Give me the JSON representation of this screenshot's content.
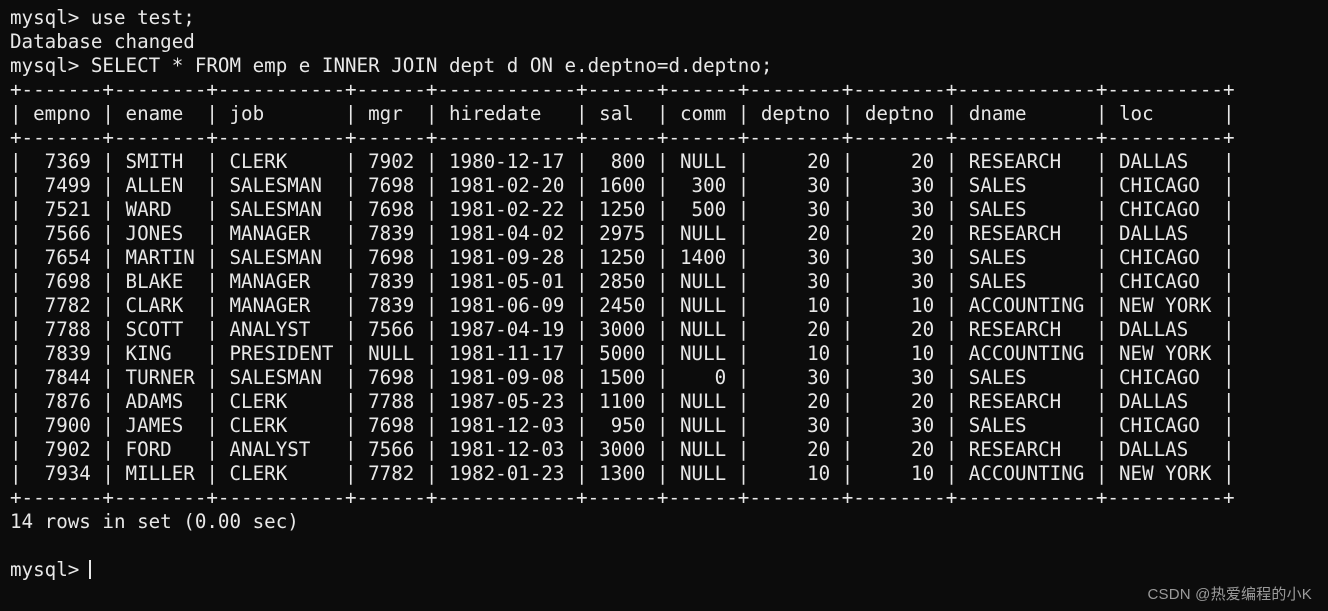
{
  "terminal": {
    "background_color": "#0c0c0c",
    "text_color": "#e8e8e8",
    "prompt": "mysql>",
    "session": [
      {
        "kind": "command",
        "text": "mysql> use test;"
      },
      {
        "kind": "output",
        "text": "Database changed"
      },
      {
        "kind": "command",
        "text": "mysql> SELECT * FROM emp e INNER JOIN dept d ON e.deptno=d.deptno;"
      }
    ],
    "result_footer": "14 rows in set (0.00 sec)",
    "blank_line": "",
    "final_prompt": "mysql>",
    "cursor": "block-cursor"
  },
  "query": {
    "use_statement": "use test;",
    "database": "test",
    "select_statement": "SELECT * FROM emp e INNER JOIN dept d ON e.deptno=d.deptno;",
    "row_count": 14,
    "elapsed": "0.00 sec"
  },
  "result_table": {
    "rule_top": "+-------+--------+-----------+------+------------+------+------+--------+--------+------------+----------+",
    "rule_mid": "+-------+--------+-----------+------+------------+------+------+--------+--------+------------+----------+",
    "rule_bottom": "+-------+--------+-----------+------+------------+------+------+--------+--------+------------+----------+",
    "columns": [
      {
        "name": "empno",
        "width": 5,
        "align": "right"
      },
      {
        "name": "ename",
        "width": 6,
        "align": "left"
      },
      {
        "name": "job",
        "width": 9,
        "align": "left"
      },
      {
        "name": "mgr",
        "width": 4,
        "align": "right"
      },
      {
        "name": "hiredate",
        "width": 10,
        "align": "left"
      },
      {
        "name": "sal",
        "width": 4,
        "align": "right"
      },
      {
        "name": "comm",
        "width": 4,
        "align": "right"
      },
      {
        "name": "deptno",
        "width": 6,
        "align": "right"
      },
      {
        "name": "deptno",
        "width": 6,
        "align": "right"
      },
      {
        "name": "dname",
        "width": 10,
        "align": "left"
      },
      {
        "name": "loc",
        "width": 8,
        "align": "left"
      }
    ],
    "header_line": "| empno | ename  | job       | mgr  | hiredate   | sal  | comm | deptno | deptno | dname      | loc      |",
    "rows": [
      {
        "empno": "7369",
        "ename": "SMITH",
        "job": "CLERK",
        "mgr": "7902",
        "hiredate": "1980-12-17",
        "sal": "800",
        "comm": "NULL",
        "e_deptno": "20",
        "d_deptno": "20",
        "dname": "RESEARCH",
        "loc": "DALLAS"
      },
      {
        "empno": "7499",
        "ename": "ALLEN",
        "job": "SALESMAN",
        "mgr": "7698",
        "hiredate": "1981-02-20",
        "sal": "1600",
        "comm": "300",
        "e_deptno": "30",
        "d_deptno": "30",
        "dname": "SALES",
        "loc": "CHICAGO"
      },
      {
        "empno": "7521",
        "ename": "WARD",
        "job": "SALESMAN",
        "mgr": "7698",
        "hiredate": "1981-02-22",
        "sal": "1250",
        "comm": "500",
        "e_deptno": "30",
        "d_deptno": "30",
        "dname": "SALES",
        "loc": "CHICAGO"
      },
      {
        "empno": "7566",
        "ename": "JONES",
        "job": "MANAGER",
        "mgr": "7839",
        "hiredate": "1981-04-02",
        "sal": "2975",
        "comm": "NULL",
        "e_deptno": "20",
        "d_deptno": "20",
        "dname": "RESEARCH",
        "loc": "DALLAS"
      },
      {
        "empno": "7654",
        "ename": "MARTIN",
        "job": "SALESMAN",
        "mgr": "7698",
        "hiredate": "1981-09-28",
        "sal": "1250",
        "comm": "1400",
        "e_deptno": "30",
        "d_deptno": "30",
        "dname": "SALES",
        "loc": "CHICAGO"
      },
      {
        "empno": "7698",
        "ename": "BLAKE",
        "job": "MANAGER",
        "mgr": "7839",
        "hiredate": "1981-05-01",
        "sal": "2850",
        "comm": "NULL",
        "e_deptno": "30",
        "d_deptno": "30",
        "dname": "SALES",
        "loc": "CHICAGO"
      },
      {
        "empno": "7782",
        "ename": "CLARK",
        "job": "MANAGER",
        "mgr": "7839",
        "hiredate": "1981-06-09",
        "sal": "2450",
        "comm": "NULL",
        "e_deptno": "10",
        "d_deptno": "10",
        "dname": "ACCOUNTING",
        "loc": "NEW YORK"
      },
      {
        "empno": "7788",
        "ename": "SCOTT",
        "job": "ANALYST",
        "mgr": "7566",
        "hiredate": "1987-04-19",
        "sal": "3000",
        "comm": "NULL",
        "e_deptno": "20",
        "d_deptno": "20",
        "dname": "RESEARCH",
        "loc": "DALLAS"
      },
      {
        "empno": "7839",
        "ename": "KING",
        "job": "PRESIDENT",
        "mgr": "NULL",
        "hiredate": "1981-11-17",
        "sal": "5000",
        "comm": "NULL",
        "e_deptno": "10",
        "d_deptno": "10",
        "dname": "ACCOUNTING",
        "loc": "NEW YORK"
      },
      {
        "empno": "7844",
        "ename": "TURNER",
        "job": "SALESMAN",
        "mgr": "7698",
        "hiredate": "1981-09-08",
        "sal": "1500",
        "comm": "0",
        "e_deptno": "30",
        "d_deptno": "30",
        "dname": "SALES",
        "loc": "CHICAGO"
      },
      {
        "empno": "7876",
        "ename": "ADAMS",
        "job": "CLERK",
        "mgr": "7788",
        "hiredate": "1987-05-23",
        "sal": "1100",
        "comm": "NULL",
        "e_deptno": "20",
        "d_deptno": "20",
        "dname": "RESEARCH",
        "loc": "DALLAS"
      },
      {
        "empno": "7900",
        "ename": "JAMES",
        "job": "CLERK",
        "mgr": "7698",
        "hiredate": "1981-12-03",
        "sal": "950",
        "comm": "NULL",
        "e_deptno": "30",
        "d_deptno": "30",
        "dname": "SALES",
        "loc": "CHICAGO"
      },
      {
        "empno": "7902",
        "ename": "FORD",
        "job": "ANALYST",
        "mgr": "7566",
        "hiredate": "1981-12-03",
        "sal": "3000",
        "comm": "NULL",
        "e_deptno": "20",
        "d_deptno": "20",
        "dname": "RESEARCH",
        "loc": "DALLAS"
      },
      {
        "empno": "7934",
        "ename": "MILLER",
        "job": "CLERK",
        "mgr": "7782",
        "hiredate": "1982-01-23",
        "sal": "1300",
        "comm": "NULL",
        "e_deptno": "10",
        "d_deptno": "10",
        "dname": "ACCOUNTING",
        "loc": "NEW YORK"
      }
    ]
  },
  "watermark": {
    "text": "CSDN @热爱编程的小K",
    "color": "#9b9b9b"
  }
}
